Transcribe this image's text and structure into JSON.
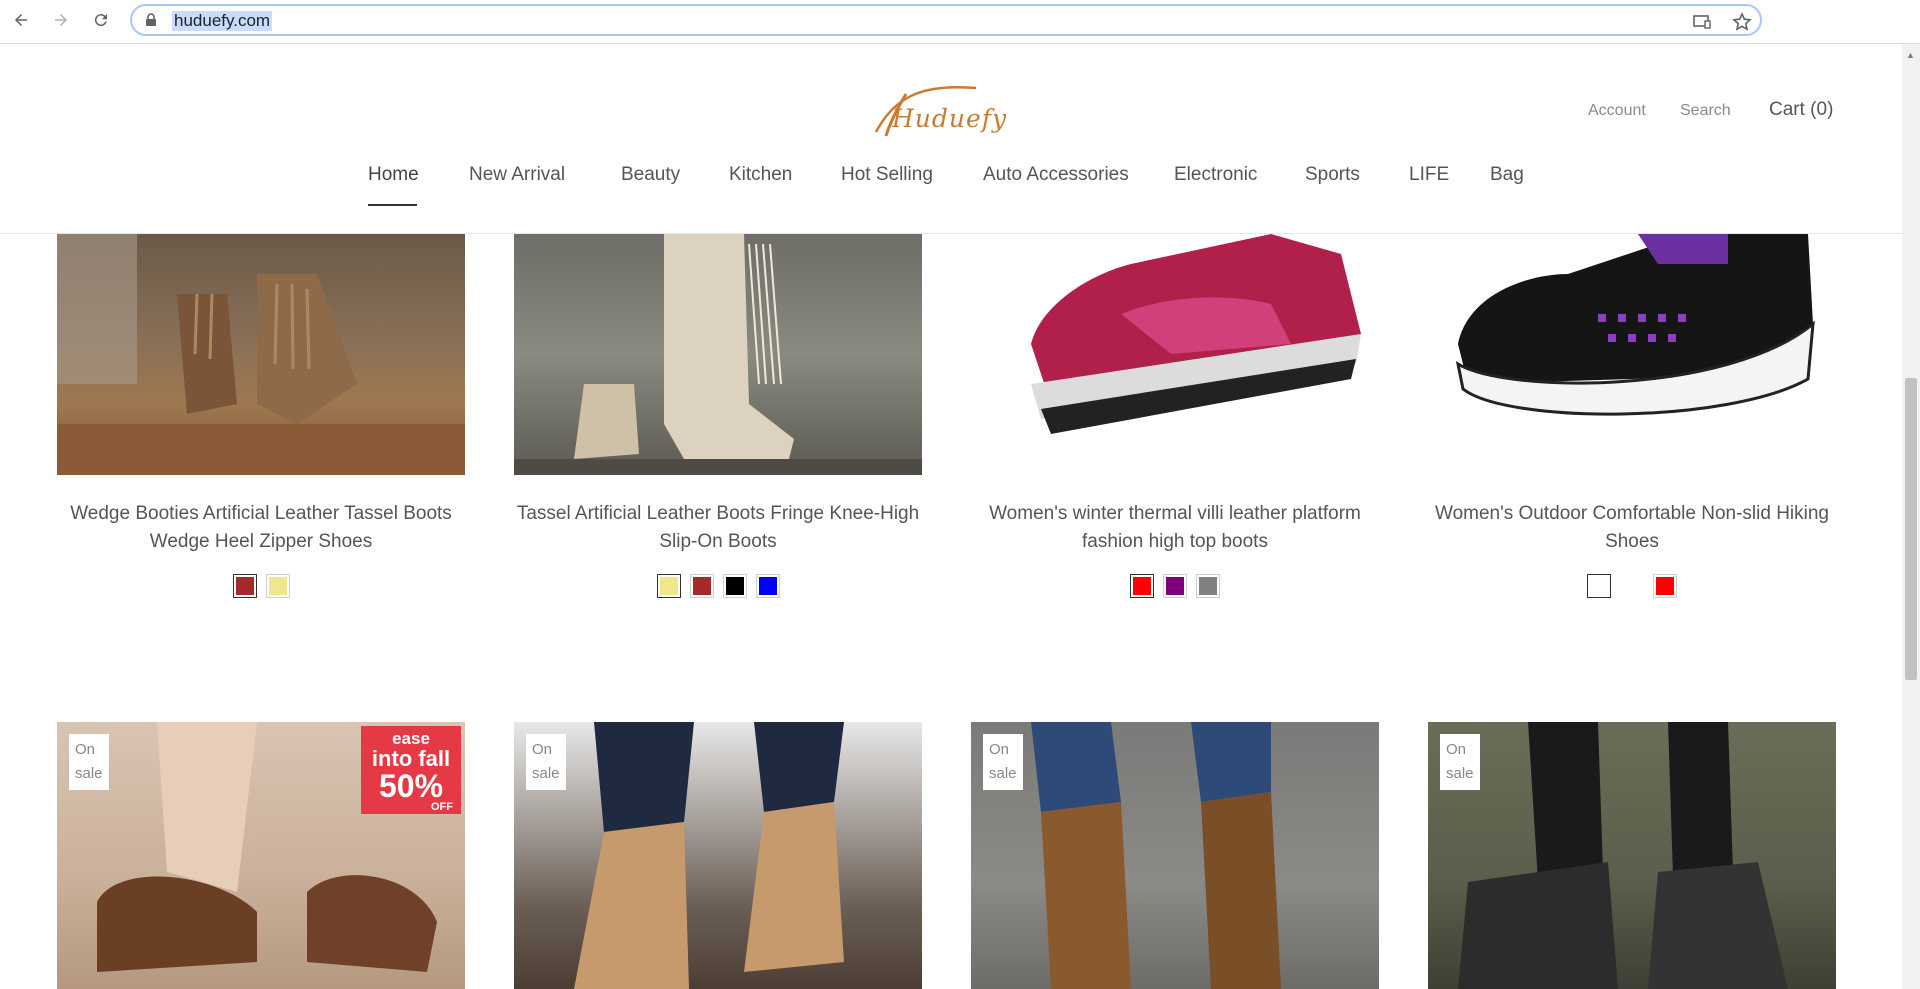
{
  "browser": {
    "url": "huduefy.com"
  },
  "site": {
    "logo_text": "Huduefy",
    "account_label": "Account",
    "search_label": "Search",
    "cart_label": "Cart (0)"
  },
  "nav": [
    {
      "label": "Home"
    },
    {
      "label": "New Arrival"
    },
    {
      "label": "Beauty"
    },
    {
      "label": "Kitchen"
    },
    {
      "label": "Hot Selling"
    },
    {
      "label": "Auto Accessories"
    },
    {
      "label": "Electronic"
    },
    {
      "label": "Sports"
    },
    {
      "label": "LIFE"
    },
    {
      "label": "Bag"
    }
  ],
  "products_row1": [
    {
      "title": "Wedge Booties Artificial Leather Tassel Boots Wedge Heel Zipper Shoes",
      "swatches": [
        "#a52a2a",
        "#f0e68c"
      ]
    },
    {
      "title": "Tassel Artificial Leather Boots Fringe Knee-High Slip-On Boots",
      "swatches": [
        "#f0e68c",
        "#a52a2a",
        "#000000",
        "#0000ff"
      ]
    },
    {
      "title": "Women's winter thermal villi leather platform fashion high top boots",
      "swatches": [
        "#ff0000",
        "#800080",
        "#808080"
      ]
    },
    {
      "title": "Women's Outdoor Comfortable Non-slid Hiking Shoes",
      "swatches": [
        "#ffffff",
        "#ffffff",
        "#ff0000"
      ]
    }
  ],
  "products_row2": [
    {
      "badge": "On sale",
      "promo_line1": "ease",
      "promo_line2": "into fall",
      "promo_line3": "50%",
      "promo_line4": "OFF"
    },
    {
      "badge": "On sale"
    },
    {
      "badge": "On sale"
    },
    {
      "badge": "On sale"
    }
  ],
  "colors": {
    "accent_logo": "#c97b32",
    "text": "#555555"
  }
}
